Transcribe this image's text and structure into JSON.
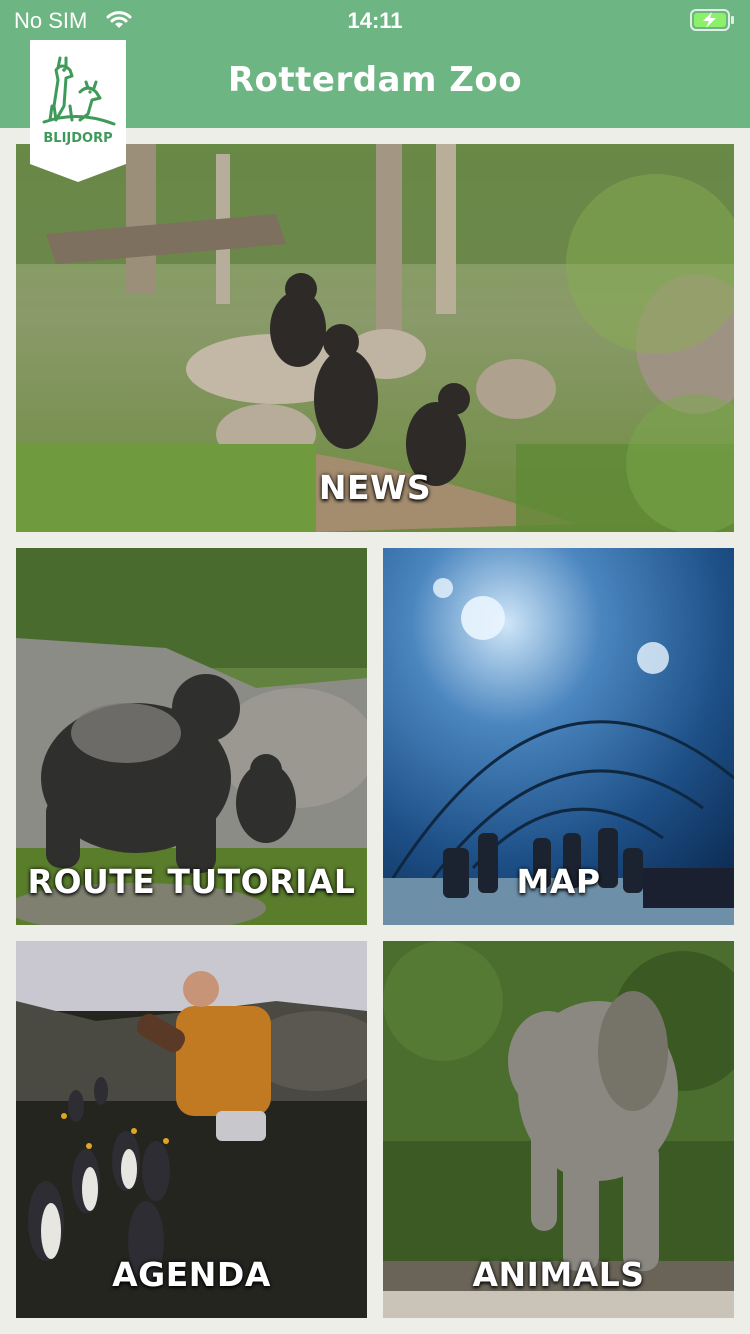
{
  "status_bar": {
    "carrier": "No SIM",
    "time": "14:11",
    "wifi_icon": "wifi-icon",
    "battery_icon": "battery-charging-icon"
  },
  "header": {
    "title": "Rotterdam Zoo",
    "logo_text": "BLIJDORP",
    "background_color": "#6db582"
  },
  "tiles": [
    {
      "id": "news",
      "label": "NEWS",
      "image": "gorillas-enclosure"
    },
    {
      "id": "route_tutorial",
      "label": "ROUTE TUTORIAL",
      "image": "silverback-gorilla"
    },
    {
      "id": "map",
      "label": "MAP",
      "image": "aquarium-tunnel"
    },
    {
      "id": "agenda",
      "label": "AGENDA",
      "image": "zookeeper-feeding-penguins"
    },
    {
      "id": "animals",
      "label": "ANIMALS",
      "image": "young-elephant"
    }
  ]
}
